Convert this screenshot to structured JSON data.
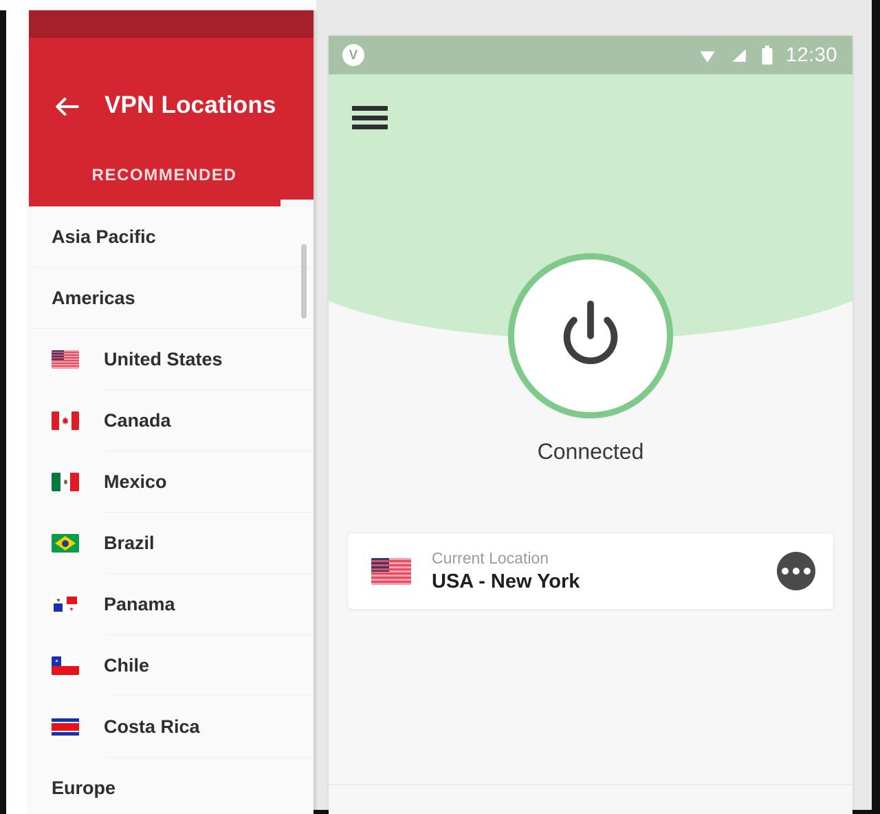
{
  "colors": {
    "vpn_appbar": "#d32630",
    "vpn_statusbar": "#a4202a",
    "phone_green": "#cdebcd",
    "phone_statusbar": "#a7c2a6",
    "power_ring": "#7fc98b",
    "more_button": "#4a4a4a"
  },
  "vpn_panel": {
    "back_icon": "arrow-left-icon",
    "title": "VPN Locations",
    "tabs": [
      {
        "label": "RECOMMENDED",
        "selected": true
      }
    ],
    "list": [
      {
        "type": "section",
        "label": "Asia Pacific"
      },
      {
        "type": "section",
        "label": "Americas"
      },
      {
        "type": "country",
        "label": "United States",
        "flag": "us"
      },
      {
        "type": "country",
        "label": "Canada",
        "flag": "ca"
      },
      {
        "type": "country",
        "label": "Mexico",
        "flag": "mx"
      },
      {
        "type": "country",
        "label": "Brazil",
        "flag": "br"
      },
      {
        "type": "country",
        "label": "Panama",
        "flag": "pa"
      },
      {
        "type": "country",
        "label": "Chile",
        "flag": "cl"
      },
      {
        "type": "country",
        "label": "Costa Rica",
        "flag": "cr"
      },
      {
        "type": "section",
        "label": "Europe"
      }
    ]
  },
  "phone": {
    "status_bar": {
      "app_icon": "vpn-app-icon",
      "app_icon_glyph": "V",
      "wifi_icon": "wifi-icon",
      "signal_icon": "cellular-signal-icon",
      "battery_icon": "battery-icon",
      "time": "12:30"
    },
    "menu_icon": "hamburger-menu-icon",
    "power_button": {
      "icon": "power-icon",
      "state": "on"
    },
    "connection_status": "Connected",
    "location_card": {
      "flag": "us",
      "subtitle": "Current Location",
      "title": "USA - New York",
      "more_icon": "more-options-icon"
    }
  }
}
